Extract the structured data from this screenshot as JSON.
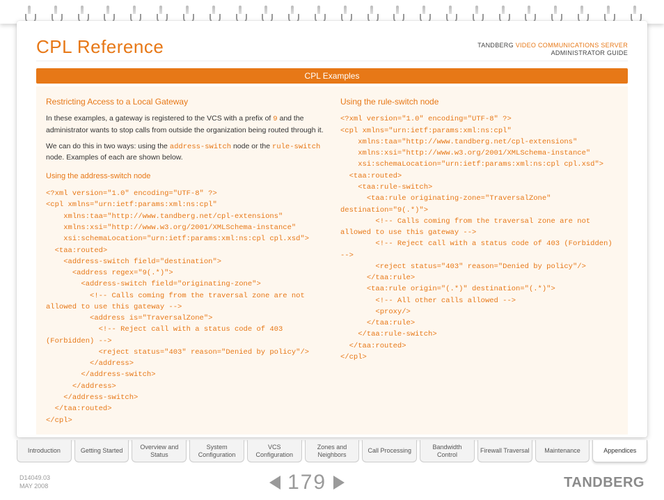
{
  "header": {
    "title": "CPL Reference",
    "brand_prefix": "TANDBERG ",
    "brand_product": "VIDEO COMMUNICATIONS SERVER",
    "brand_sub": "ADMINISTRATOR GUIDE",
    "section": "CPL Examples"
  },
  "left": {
    "heading": "Restricting Access to a Local Gateway",
    "p1a": "In these examples, a gateway is registered to the VCS with a prefix of ",
    "p1_prefix": "9",
    "p1b": " and the administrator wants to stop calls from outside the organization being routed through it.",
    "p2a": "We can do this in two ways: using the ",
    "p2_kw1": "address-switch",
    "p2b": " node or the ",
    "p2_kw2": "rule-switch",
    "p2c": " node. Examples of each are shown below.",
    "subheading": "Using the address-switch node",
    "code": "<?xml version=\"1.0\" encoding=\"UTF-8\" ?>\n<cpl xmlns=\"urn:ietf:params:xml:ns:cpl\"\n    xmlns:taa=\"http://www.tandberg.net/cpl-extensions\"\n    xmlns:xsi=\"http://www.w3.org/2001/XMLSchema-instance\"\n    xsi:schemaLocation=\"urn:ietf:params:xml:ns:cpl cpl.xsd\">\n  <taa:routed>\n    <address-switch field=\"destination\">\n      <address regex=\"9(.*)\">\n        <address-switch field=\"originating-zone\">\n          <!-- Calls coming from the traversal zone are not allowed to use this gateway -->\n          <address is=\"TraversalZone\">\n            <!-- Reject call with a status code of 403 (Forbidden) -->\n            <reject status=\"403\" reason=\"Denied by policy\"/>\n          </address>\n        </address-switch>\n      </address>\n    </address-switch>\n  </taa:routed>\n</cpl>"
  },
  "right": {
    "heading": "Using the rule-switch node",
    "code": "<?xml version=\"1.0\" encoding=\"UTF-8\" ?>\n<cpl xmlns=\"urn:ietf:params:xml:ns:cpl\"\n    xmlns:taa=\"http://www.tandberg.net/cpl-extensions\"\n    xmlns:xsi=\"http://www.w3.org/2001/XMLSchema-instance\"\n    xsi:schemaLocation=\"urn:ietf:params:xml:ns:cpl cpl.xsd\">\n  <taa:routed>\n    <taa:rule-switch>\n      <taa:rule originating-zone=\"TraversalZone\" destination=\"9(.*)\">\n        <!-- Calls coming from the traversal zone are not allowed to use this gateway -->\n        <!-- Reject call with a status code of 403 (Forbidden) -->\n        <reject status=\"403\" reason=\"Denied by policy\"/>\n      </taa:rule>\n      <taa:rule origin=\"(.*)\" destination=\"(.*)\">\n        <!-- All other calls allowed -->\n        <proxy/>\n      </taa:rule>\n    </taa:rule-switch>\n  </taa:routed>\n</cpl>"
  },
  "tabs": [
    "Introduction",
    "Getting Started",
    "Overview and Status",
    "System Configuration",
    "VCS Configuration",
    "Zones and Neighbors",
    "Call Processing",
    "Bandwidth Control",
    "Firewall Traversal",
    "Maintenance",
    "Appendices"
  ],
  "footer": {
    "docid": "D14049.03",
    "date": "MAY 2008",
    "page": "179",
    "logo": "TANDBERG"
  }
}
